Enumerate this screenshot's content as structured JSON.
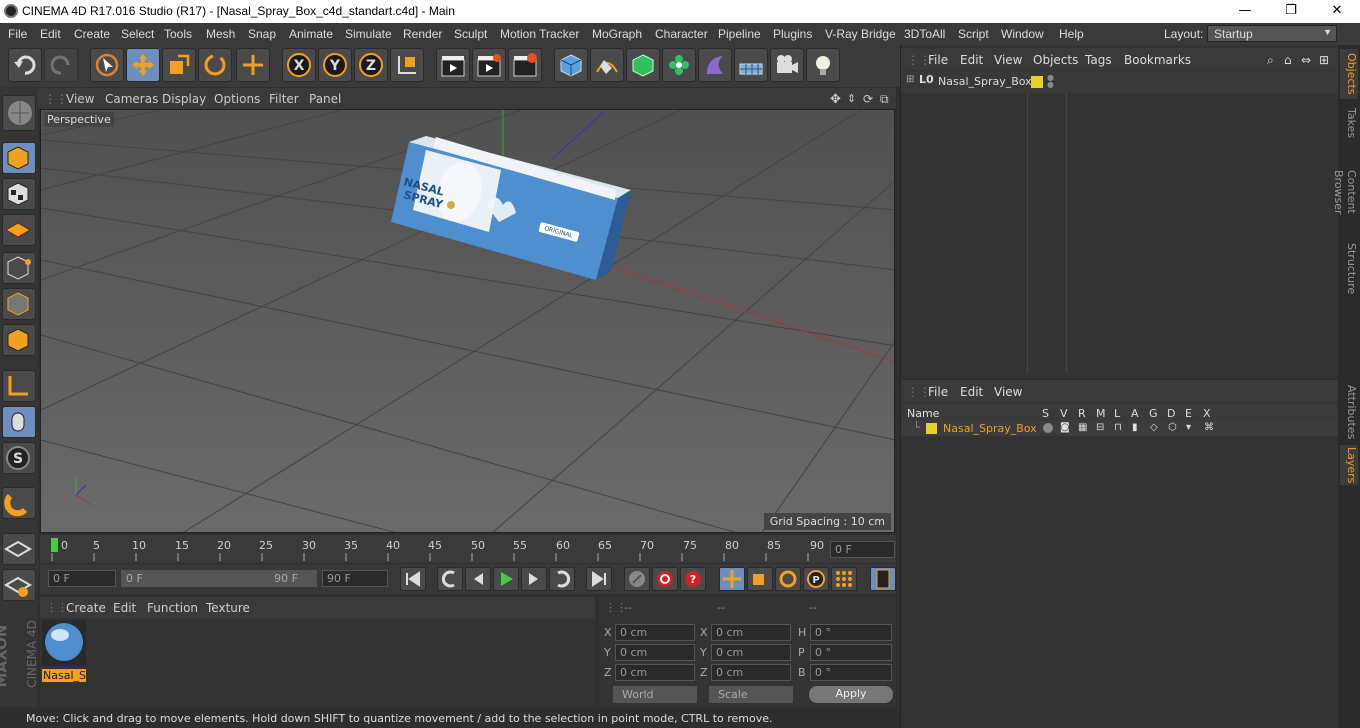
{
  "window": {
    "title": "CINEMA 4D R17.016 Studio (R17) - [Nasal_Spray_Box_c4d_standart.c4d] - Main",
    "min": "—",
    "max": "❐",
    "close": "✕"
  },
  "menubar": {
    "items": [
      "File",
      "Edit",
      "Create",
      "Select",
      "Tools",
      "Mesh",
      "Snap",
      "Animate",
      "Simulate",
      "Render",
      "Sculpt",
      "Motion Tracker",
      "MoGraph",
      "Character",
      "Pipeline",
      "Plugins",
      "V-Ray Bridge",
      "3DToAll",
      "Script",
      "Window",
      "Help"
    ],
    "layout_label": "Layout:",
    "layout_value": "Startup"
  },
  "viewport": {
    "menu": [
      "View",
      "Cameras",
      "Display",
      "Options",
      "Filter",
      "Panel"
    ],
    "label": "Perspective",
    "grid_spacing": "Grid Spacing : 10 cm"
  },
  "box": {
    "line1": "NASAL",
    "line2": "SPRAY",
    "badge": "ORIGINAL"
  },
  "timeline": {
    "ticks": [
      "0",
      "5",
      "10",
      "15",
      "20",
      "25",
      "30",
      "35",
      "40",
      "45",
      "50",
      "55",
      "60",
      "65",
      "70",
      "75",
      "80",
      "85",
      "90"
    ],
    "current": "0 F",
    "start": "0 F",
    "range_start": "0 F",
    "range_end": "90 F",
    "end": "90 F"
  },
  "materials": {
    "menu": [
      "Create",
      "Edit",
      "Function",
      "Texture"
    ],
    "mat_name": "Nasal_Sp"
  },
  "coords": {
    "h1": "--",
    "h2": "--",
    "h3": "--",
    "rows": [
      {
        "a": "X",
        "av": "0 cm",
        "b": "X",
        "bv": "0 cm",
        "c": "H",
        "cv": "0 °"
      },
      {
        "a": "Y",
        "av": "0 cm",
        "b": "Y",
        "bv": "0 cm",
        "c": "P",
        "cv": "0 °"
      },
      {
        "a": "Z",
        "av": "0 cm",
        "b": "Z",
        "bv": "0 cm",
        "c": "B",
        "cv": "0 °"
      }
    ],
    "world": "World",
    "scale": "Scale",
    "apply": "Apply"
  },
  "objects": {
    "menu": [
      "File",
      "Edit",
      "View",
      "Objects",
      "Tags",
      "Bookmarks"
    ],
    "item": "Nasal_Spray_Box"
  },
  "layers": {
    "menu": [
      "File",
      "Edit",
      "View"
    ],
    "cols": [
      "Name",
      "S",
      "V",
      "R",
      "M",
      "L",
      "A",
      "G",
      "D",
      "E",
      "X"
    ],
    "item": "Nasal_Spray_Box"
  },
  "sidetabs": {
    "right_top": [
      "Objects",
      "Takes",
      "Content Browser",
      "Structure"
    ],
    "right_bottom": [
      "Attributes",
      "Layers"
    ]
  },
  "brand": {
    "maxon": "MAXON",
    "c4d": "CINEMA 4D"
  },
  "status": "Move: Click and drag to move elements. Hold down SHIFT to quantize movement / add to the selection in point mode, CTRL to remove."
}
